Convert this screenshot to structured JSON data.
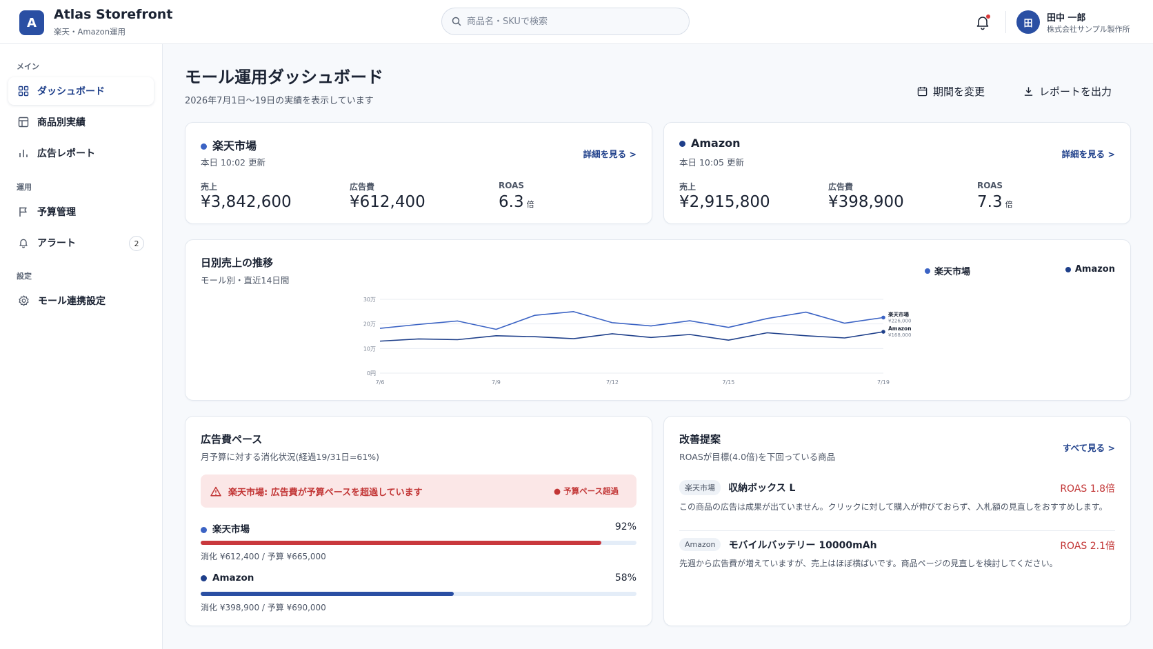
{
  "app": {
    "logo_letter": "A",
    "name": "Atlas Storefront",
    "subtitle": "楽天・Amazon運用"
  },
  "search": {
    "placeholder": "商品名・SKUで検索"
  },
  "user": {
    "initial": "田",
    "name": "田中 一郎",
    "company": "株式会社サンプル製作所"
  },
  "sidebar": {
    "sections": [
      "メイン",
      "運用",
      "設定"
    ],
    "items": [
      {
        "label": "ダッシュボード",
        "icon": "grid-icon",
        "active": true
      },
      {
        "label": "商品別実績",
        "icon": "table-icon"
      },
      {
        "label": "広告レポート",
        "icon": "bar-chart-icon"
      },
      {
        "label": "予算管理",
        "icon": "flag-icon"
      },
      {
        "label": "アラート",
        "icon": "bell-icon",
        "badge": "2"
      },
      {
        "label": "モール連携設定",
        "icon": "gear-icon"
      }
    ]
  },
  "page": {
    "title": "モール運用ダッシュボード",
    "subtitle": "2026年7月1日〜19日の実績を表示しています",
    "period_button": "期間を変更",
    "export_button": "レポートを出力"
  },
  "malls": [
    {
      "name": "楽天市場",
      "updated": "本日 10:02 更新",
      "link": "詳細を見る >",
      "sales_label": "売上",
      "sales": "¥3,842,600",
      "ad_label": "広告費",
      "ad": "¥612,400",
      "roas_label": "ROAS",
      "roas": "6.3",
      "roas_unit": "倍",
      "color": "#3b63c4"
    },
    {
      "name": "Amazon",
      "updated": "本日 10:05 更新",
      "link": "詳細を見る >",
      "sales_label": "売上",
      "sales": "¥2,915,800",
      "ad_label": "広告費",
      "ad": "¥398,900",
      "roas_label": "ROAS",
      "roas": "7.3",
      "roas_unit": "倍",
      "color": "#1e3f8a"
    }
  ],
  "sales_chart": {
    "title": "日別売上の推移",
    "subtitle": "モール別・直近14日間",
    "legend": [
      "楽天市場",
      "Amazon"
    ]
  },
  "chart_data": {
    "type": "line",
    "x": [
      "7/6",
      "7/7",
      "7/8",
      "7/9",
      "7/10",
      "7/11",
      "7/12",
      "7/13",
      "7/14",
      "7/15",
      "7/16",
      "7/17",
      "7/18",
      "7/19"
    ],
    "x_tick_labels": [
      "7/6",
      "7/9",
      "7/12",
      "7/15",
      "7/19"
    ],
    "y_tick_labels": [
      "0円",
      "10万",
      "20万",
      "30万"
    ],
    "ylim": [
      0,
      300000
    ],
    "grid": true,
    "series": [
      {
        "name": "楽天市場",
        "color": "#3b63c4",
        "values": [
          182000,
          198000,
          212000,
          178000,
          235000,
          250000,
          205000,
          192000,
          213000,
          186000,
          222000,
          248000,
          203000,
          226000
        ],
        "end_label": "¥226,000"
      },
      {
        "name": "Amazon",
        "color": "#1e3f8a",
        "values": [
          130000,
          139000,
          136000,
          152000,
          148000,
          140000,
          160000,
          145000,
          157000,
          134000,
          164000,
          152000,
          143000,
          168000
        ],
        "end_label": "¥168,000"
      }
    ]
  },
  "ad_pace": {
    "title": "広告費ペース",
    "subtitle": "月予算に対する消化状況(経過19/31日=61%)",
    "alert_text": "楽天市場: 広告費が予算ペースを超過しています",
    "alert_tag": "● 予算ペース超過",
    "bars": [
      {
        "name": "楽天市場",
        "percent": "92%",
        "fill": 0.92,
        "note": "消化 ¥612,400 / 予算 ¥665,000",
        "color": "#c9383d",
        "dot": "#3b63c4"
      },
      {
        "name": "Amazon",
        "percent": "58%",
        "fill": 0.58,
        "note": "消化 ¥398,900 / 予算 ¥690,000",
        "color": "#2a4fa3",
        "dot": "#1e3f8a"
      }
    ]
  },
  "suggestions": {
    "title": "改善提案",
    "subtitle": "ROASが目標(4.0倍)を下回っている商品",
    "link": "すべて見る >",
    "items": [
      {
        "mall": "楽天市場",
        "product": "収納ボックス L",
        "roas": "ROAS 1.8倍",
        "desc": "この商品の広告は成果が出ていません。クリックに対して購入が伸びておらず、入札額の見直しをおすすめします。"
      },
      {
        "mall": "Amazon",
        "product": "モバイルバッテリー 10000mAh",
        "roas": "ROAS 2.1倍",
        "desc": "先週から広告費が増えていますが、売上はほぼ横ばいです。商品ページの見直しを検討してください。"
      }
    ]
  }
}
